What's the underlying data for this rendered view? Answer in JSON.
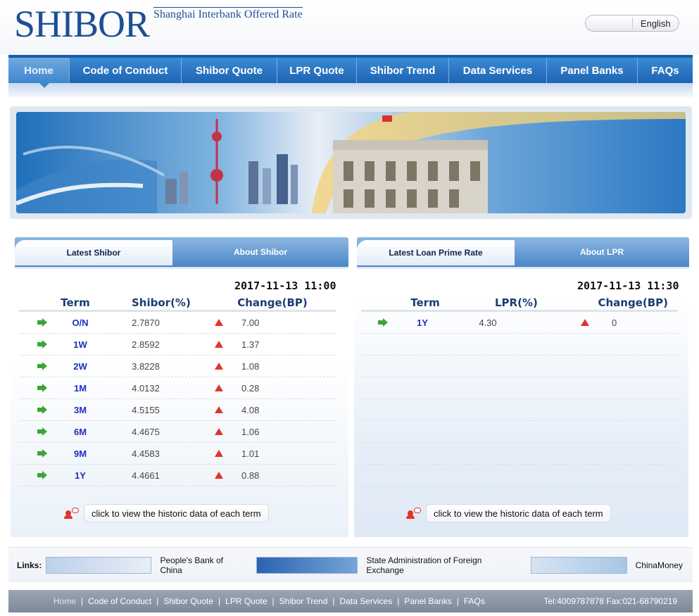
{
  "header": {
    "logo_main": "SHIBOR",
    "logo_cn": "",
    "logo_en": "Shanghai Interbank Offered Rate",
    "lang_cn": "",
    "lang_en": "English"
  },
  "nav": {
    "items": [
      {
        "label": "Home",
        "active": true
      },
      {
        "label": "Code of Conduct"
      },
      {
        "label": "Shibor Quote"
      },
      {
        "label": "LPR Quote"
      },
      {
        "label": "Shibor Trend"
      },
      {
        "label": "Data Services"
      },
      {
        "label": "Panel Banks"
      },
      {
        "label": "FAQs"
      }
    ]
  },
  "shibor_panel": {
    "tabs": [
      "Latest Shibor",
      "About Shibor"
    ],
    "timestamp": "2017-11-13 11:00",
    "headers": [
      "Term",
      "Shibor(%)",
      "Change(BP)"
    ],
    "rows": [
      {
        "term": "O/N",
        "rate": "2.7870",
        "change": "7.00"
      },
      {
        "term": "1W",
        "rate": "2.8592",
        "change": "1.37"
      },
      {
        "term": "2W",
        "rate": "3.8228",
        "change": "1.08"
      },
      {
        "term": "1M",
        "rate": "4.0132",
        "change": "0.28"
      },
      {
        "term": "3M",
        "rate": "4.5155",
        "change": "4.08"
      },
      {
        "term": "6M",
        "rate": "4.4675",
        "change": "1.06"
      },
      {
        "term": "9M",
        "rate": "4.4583",
        "change": "1.01"
      },
      {
        "term": "1Y",
        "rate": "4.4661",
        "change": "0.88"
      }
    ],
    "history_link": "click to view the historic data of each term"
  },
  "lpr_panel": {
    "tabs": [
      "Latest Loan Prime Rate",
      "About LPR"
    ],
    "timestamp": "2017-11-13 11:30",
    "headers": [
      "Term",
      "LPR(%)",
      "Change(BP)"
    ],
    "rows": [
      {
        "term": "1Y",
        "rate": "4.30",
        "change": "0"
      }
    ],
    "history_link": "click to view the historic data of each term"
  },
  "links": {
    "label": "Links:",
    "items": [
      {
        "logo_text": "",
        "text": "People's Bank of China"
      },
      {
        "logo_text": "",
        "text": "State Administration of Foreign Exchange"
      },
      {
        "logo_text": "",
        "text": "ChinaMoney"
      }
    ]
  },
  "footer": {
    "items": [
      "Home",
      "Code of Conduct",
      "Shibor Quote",
      "LPR Quote",
      "Shibor Trend",
      "Data Services",
      "Panel Banks",
      "FAQs"
    ],
    "contact": "Tel:4009787878  Fax:021-68790219"
  },
  "colors": {
    "brand_blue": "#1d4f93",
    "nav_blue": "#2a72c0",
    "up_red": "#e2342b",
    "arrow_green": "#3aa634",
    "term_blue": "#1f2fbf"
  }
}
